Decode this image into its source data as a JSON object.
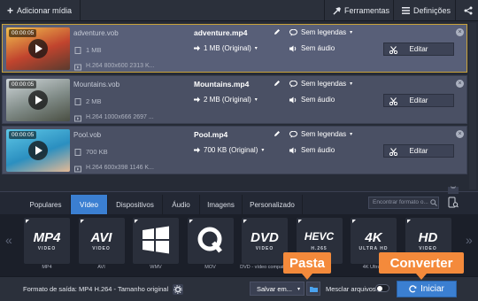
{
  "toolbar": {
    "add_media": "Adicionar mídia",
    "tools": "Ferramentas",
    "settings": "Definições"
  },
  "files": [
    {
      "duration": "00:00:05",
      "source_name": "adventure.vob",
      "source_size": "1 MB",
      "source_meta": "H.264 800x600 2313 K...",
      "output_name": "adventure.mp4",
      "output_size": "1 MB (Original)",
      "subtitles": "Sem legendas",
      "audio": "Sem áudio",
      "edit": "Editar",
      "thumb_colors": [
        "#f2c14e",
        "#c1442e",
        "#5a3b2e"
      ]
    },
    {
      "duration": "00:00:05",
      "source_name": "Mountains.vob",
      "source_size": "2 MB",
      "source_meta": "H.264 1000x666 2697 ...",
      "output_name": "Mountains.mp4",
      "output_size": "2 MB (Original)",
      "subtitles": "Sem legendas",
      "audio": "Sem áudio",
      "edit": "Editar",
      "thumb_colors": [
        "#cfd6d9",
        "#7f8a86",
        "#4a4f43"
      ]
    },
    {
      "duration": "00:00:05",
      "source_name": "Pool.vob",
      "source_size": "700 KB",
      "source_meta": "H.264 600x398 1146 K...",
      "output_name": "Pool.mp4",
      "output_size": "700 KB (Original)",
      "subtitles": "Sem legendas",
      "audio": "Sem áudio",
      "edit": "Editar",
      "thumb_colors": [
        "#5ec7e6",
        "#2b8fc0",
        "#e5b995"
      ]
    }
  ],
  "tabs": [
    "Populares",
    "Vídeo",
    "Dispositivos",
    "Áudio",
    "Imagens",
    "Personalizado"
  ],
  "active_tab": "Vídeo",
  "search_placeholder": "Encontrar formato o...",
  "formats": [
    {
      "badge": "MP4",
      "sub": "VIDEO",
      "label": "MP4"
    },
    {
      "badge": "AVI",
      "sub": "VIDEO",
      "label": "AVI"
    },
    {
      "badge": "WMV",
      "sub": "",
      "label": "WMV"
    },
    {
      "badge": "MOV",
      "sub": "",
      "label": "MOV"
    },
    {
      "badge": "DVD",
      "sub": "VIDEO",
      "label": "DVD - vídeo compatí..."
    },
    {
      "badge": "HEVC",
      "sub": "H.265",
      "label": "HEVC"
    },
    {
      "badge": "4K",
      "sub": "ULTRA HD",
      "label": "4K Ultra..."
    },
    {
      "badge": "HD",
      "sub": "VIDEO",
      "label": "HD"
    }
  ],
  "bottom": {
    "output_format": "Formato de saída: MP4 H.264 - Tamanho original",
    "save_to": "Salvar em...",
    "merge": "Mesclar arquivos",
    "start": "Iniciar"
  },
  "callouts": {
    "folder": "Pasta",
    "convert": "Converter"
  },
  "colors": {
    "accent": "#3b7fd1",
    "callout": "#f48a3b",
    "selected_border": "#c9a33a"
  }
}
